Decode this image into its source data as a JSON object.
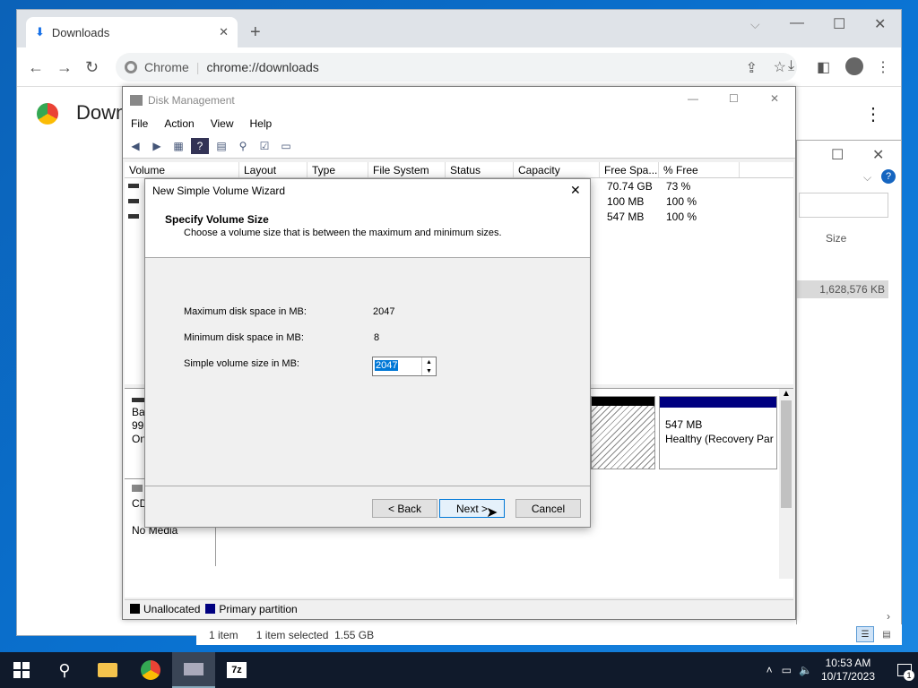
{
  "browser": {
    "tab_title": "Downloads",
    "omnibox_site": "Chrome",
    "omnibox_url": "chrome://downloads",
    "page_heading": "Downl"
  },
  "explorer": {
    "col_size": "Size",
    "file_size": "1,628,576 KB",
    "status_items": "1 item",
    "status_selected": "1 item selected  1.55 GB"
  },
  "diskmgmt": {
    "title": "Disk Management",
    "menu": [
      "File",
      "Action",
      "View",
      "Help"
    ],
    "columns": [
      "Volume",
      "Layout",
      "Type",
      "File System",
      "Status",
      "Capacity",
      "Free Spa...",
      "% Free"
    ],
    "rows": [
      {
        "free": "70.74 GB",
        "pct": "73 %"
      },
      {
        "free": "100 MB",
        "pct": "100 %"
      },
      {
        "free": "547 MB",
        "pct": "100 %"
      }
    ],
    "disk0_label_lines": [
      "Ba",
      "99.",
      "On"
    ],
    "cd_label": "CD",
    "no_media": "No Media",
    "partition_size": "547 MB",
    "partition_status": "Healthy (Recovery Par",
    "legend": [
      "Unallocated",
      "Primary partition"
    ],
    "legend_colors": [
      "#000000",
      "#000080"
    ]
  },
  "wizard": {
    "title": "New Simple Volume Wizard",
    "heading": "Specify Volume Size",
    "subheading": "Choose a volume size that is between the maximum and minimum sizes.",
    "max_label": "Maximum disk space in MB:",
    "max_value": "2047",
    "min_label": "Minimum disk space in MB:",
    "min_value": "8",
    "size_label": "Simple volume size in MB:",
    "size_value": "2047",
    "back": "< Back",
    "next": "Next >",
    "cancel": "Cancel"
  },
  "taskbar": {
    "time": "10:53 AM",
    "date": "10/17/2023",
    "notification_count": "1"
  }
}
